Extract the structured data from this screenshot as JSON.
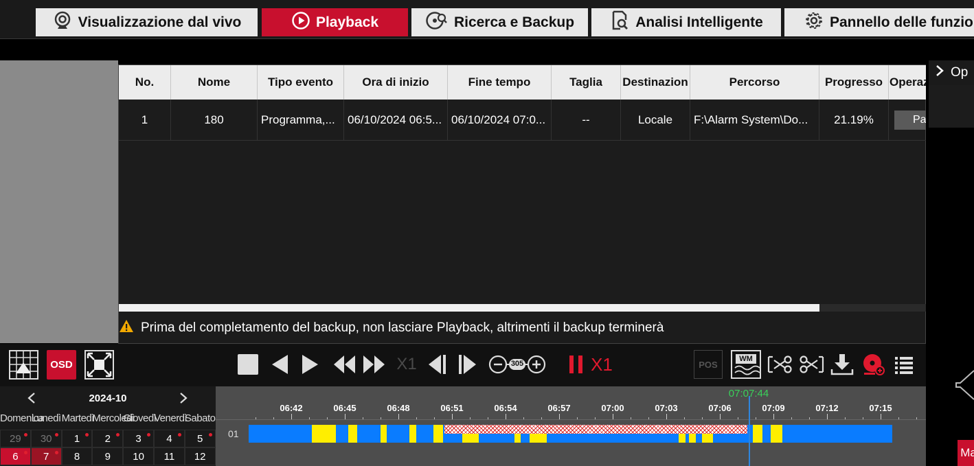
{
  "nav": {
    "tabs": [
      {
        "label": "Visualizzazione dal vivo",
        "icon": "camera-icon",
        "active": false
      },
      {
        "label": "Playback",
        "icon": "play-circle-icon",
        "active": true
      },
      {
        "label": "Ricerca e Backup",
        "icon": "disc-search-icon",
        "active": false
      },
      {
        "label": "Analisi Intelligente",
        "icon": "document-search-icon",
        "active": false
      },
      {
        "label": "Pannello delle funzioni",
        "icon": "gear-icon",
        "active": false
      }
    ]
  },
  "backup_table": {
    "columns": [
      "No.",
      "Nome",
      "Tipo evento",
      "Ora di inizio",
      "Fine tempo",
      "Taglia",
      "Destinazion",
      "Percorso",
      "Progresso",
      "Operaz"
    ],
    "rows": [
      {
        "no": "1",
        "name": "180",
        "event_type": "Programma,...",
        "start": "06/10/2024 06:5...",
        "end": "06/10/2024 07:0...",
        "size": "--",
        "destination": "Locale",
        "path": "F:\\Alarm System\\Do...",
        "progress": "21.19%",
        "operation": "Pa"
      }
    ],
    "warning": "Prima del completamento del backup, non lasciare Playback, altrimenti il backup terminerà"
  },
  "right_panel": {
    "header": "Op",
    "bottom_button": "Ma"
  },
  "toolbar": {
    "osd_label": "OSD",
    "speed_dim": "X1",
    "zoom_value": "305",
    "pos_label": "POS",
    "wm_label": "WM",
    "speed_label": "X1"
  },
  "calendar": {
    "month": "2024-10",
    "weekdays": [
      "Domenica",
      "Lunedì",
      "Martedì",
      "Mercoledì",
      "Giovedì",
      "Venerdì",
      "Sabato"
    ],
    "weeks": [
      [
        {
          "d": "29",
          "dim": true,
          "rec": true
        },
        {
          "d": "30",
          "dim": true,
          "rec": true
        },
        {
          "d": "1",
          "rec": true
        },
        {
          "d": "2",
          "rec": true
        },
        {
          "d": "3",
          "rec": true
        },
        {
          "d": "4",
          "rec": true
        },
        {
          "d": "5",
          "rec": true
        }
      ],
      [
        {
          "d": "6",
          "rec": true,
          "state": "selected"
        },
        {
          "d": "7",
          "rec": true,
          "state": "today"
        },
        {
          "d": "8"
        },
        {
          "d": "9"
        },
        {
          "d": "10"
        },
        {
          "d": "11"
        },
        {
          "d": "12"
        }
      ]
    ]
  },
  "timeline": {
    "channel": "01",
    "cursor_time": "07:07:44",
    "ticks": [
      "06:42",
      "06:45",
      "06:48",
      "06:51",
      "06:54",
      "06:57",
      "07:00",
      "07:03",
      "07:06",
      "07:09",
      "07:12",
      "07:15"
    ],
    "colors": {
      "schedule": "#0a7cff",
      "event": "#ffee00",
      "backup": "#d82a2a"
    }
  }
}
